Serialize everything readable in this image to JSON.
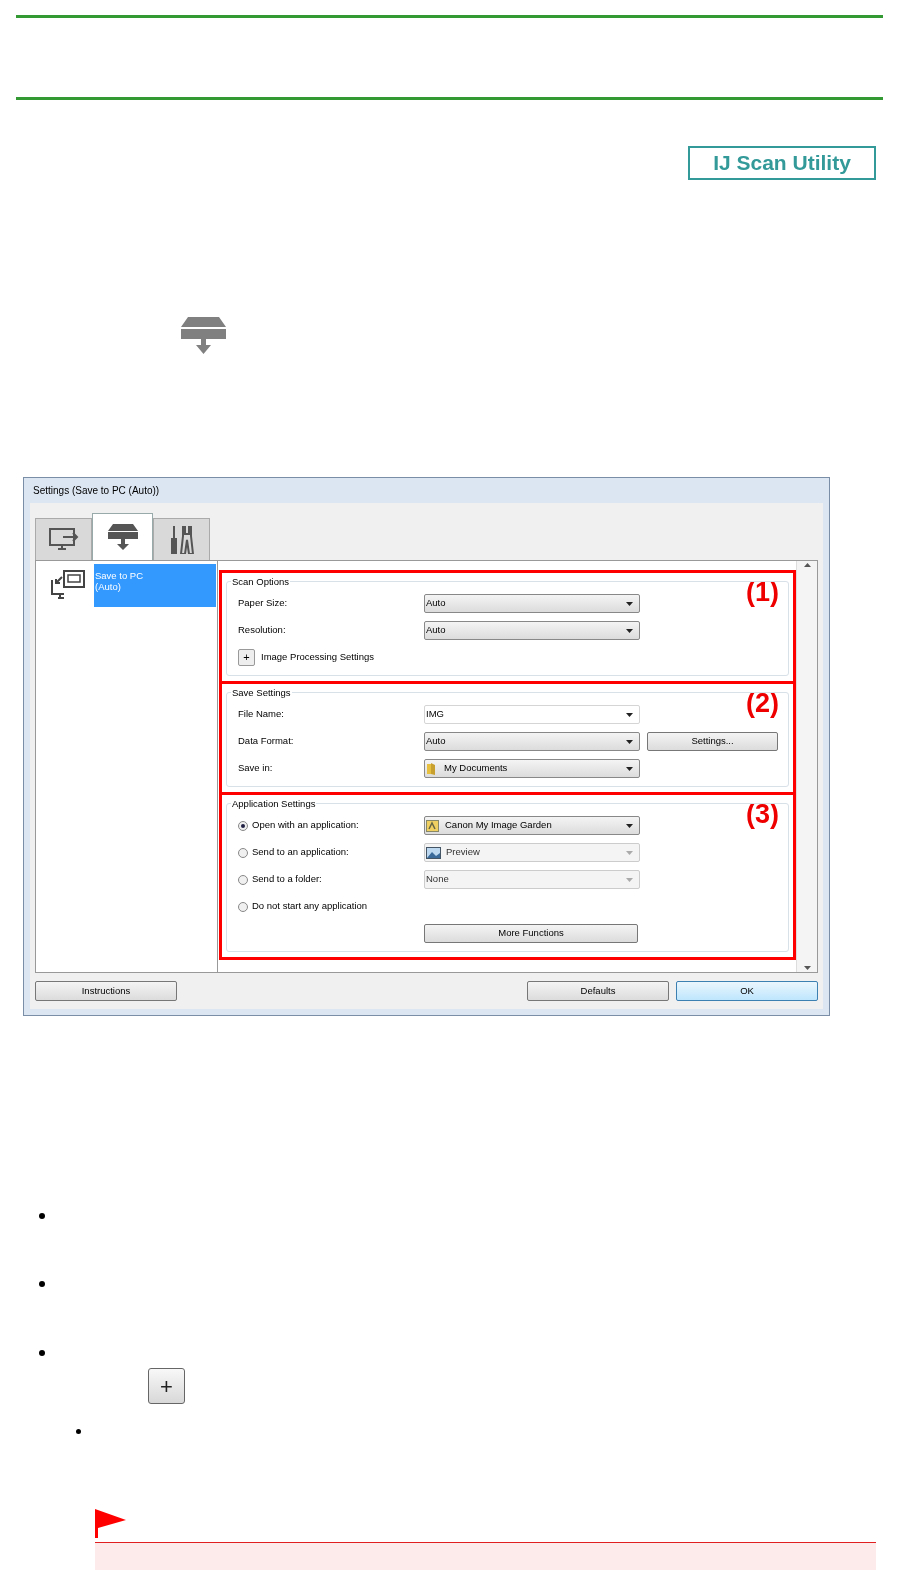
{
  "header_badge": "IJ Scan Utility",
  "dialog": {
    "title": "Settings (Save to PC (Auto))",
    "tabs": [
      {
        "kind": "computer",
        "selected": false
      },
      {
        "kind": "scanner",
        "selected": true
      },
      {
        "kind": "tools",
        "selected": false
      }
    ],
    "list_items": [
      {
        "label": "Save to PC\n(Auto)",
        "selected": true
      }
    ],
    "sections": [
      {
        "title": "Scan Options",
        "marker": "(1)",
        "rows": [
          {
            "kind": "dropdown",
            "label": "Paper Size:",
            "value": "Auto"
          },
          {
            "kind": "dropdown",
            "label": "Resolution:",
            "value": "Auto"
          },
          {
            "kind": "expander",
            "symbol": "+",
            "label": "Image Processing Settings"
          }
        ]
      },
      {
        "title": "Save Settings",
        "marker": "(2)",
        "rows": [
          {
            "kind": "combo",
            "label": "File Name:",
            "value": "IMG"
          },
          {
            "kind": "dropdown",
            "label": "Data Format:",
            "value": "Auto",
            "button": "Settings..."
          },
          {
            "kind": "dropdown",
            "label": "Save in:",
            "value": "My Documents",
            "value_icon": {
              "kind": "folder"
            }
          }
        ]
      },
      {
        "title": "Application Settings",
        "marker": "(3)",
        "rows": [
          {
            "kind": "radio",
            "label": "Open with an application:",
            "selected": true,
            "value": "Canon My Image Garden",
            "value_icon": {
              "kind": "app"
            },
            "disabled": false
          },
          {
            "kind": "radio",
            "label": "Send to an application:",
            "selected": false,
            "value": "Preview",
            "value_icon": {
              "kind": "image"
            },
            "disabled": true
          },
          {
            "kind": "radio",
            "label": "Send to a folder:",
            "selected": false,
            "value": "None",
            "disabled": true
          },
          {
            "kind": "radio",
            "label": "Do not start any application",
            "selected": false
          },
          {
            "kind": "button",
            "value": "More Functions"
          }
        ]
      }
    ],
    "buttons": [
      {
        "label": "Instructions",
        "default": false
      },
      {
        "label": "Defaults",
        "default": false
      },
      {
        "label": "OK",
        "default": true
      }
    ]
  },
  "plus_button": "+"
}
